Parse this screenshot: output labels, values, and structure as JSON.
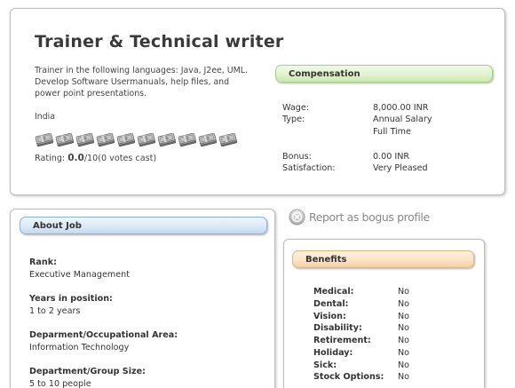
{
  "job": {
    "title": "Trainer & Technical writer",
    "description": "Trainer in the following languages: Java, J2ee, UML. Develop Software Usermanuals, help files, and power point presentations.",
    "location": "India",
    "rating_prefix": "Rating: ",
    "rating_value": "0.0",
    "rating_suffix": "/10(0 votes cast)",
    "rating_stars": 10,
    "rating_filled": 0
  },
  "compensation": {
    "header": "Compensation",
    "rows": [
      {
        "label": "Wage:",
        "value": "8,000.00 INR"
      },
      {
        "label": "Type:",
        "value": "Annual Salary"
      },
      {
        "label": "",
        "value": "Full Time"
      },
      {
        "label": "Bonus:",
        "value": "0.00 INR"
      },
      {
        "label": "Satisfaction:",
        "value": "Very Pleased"
      }
    ]
  },
  "report": {
    "label": "Report as bogus profile"
  },
  "about": {
    "header": "About Job",
    "items": [
      {
        "label": "Rank:",
        "value": "Executive Management"
      },
      {
        "label": "Years in position:",
        "value": "1 to 2 years"
      },
      {
        "label": "Deparment/Occupational Area:",
        "value": "Information Technology"
      },
      {
        "label": "Department/Group Size:",
        "value": "5 to 10 people"
      }
    ]
  },
  "benefits": {
    "header": "Benefits",
    "items": [
      {
        "label": "Medical:",
        "value": "No"
      },
      {
        "label": "Dental:",
        "value": "No"
      },
      {
        "label": "Vision:",
        "value": "No"
      },
      {
        "label": "Disability:",
        "value": "No"
      },
      {
        "label": "Retirement:",
        "value": "No"
      },
      {
        "label": "Holiday:",
        "value": "No"
      },
      {
        "label": "Sick:",
        "value": "No"
      },
      {
        "label": "Stock Options:",
        "value": "No"
      }
    ]
  },
  "colors": {
    "compensation_header": "#e1f2cd",
    "about_header": "#dbe9f7",
    "benefits_header": "#fbe3c6",
    "money_icon": "#8a8a8a"
  },
  "icons": {
    "rating": "money-stack-icon",
    "report": "circle-x-icon"
  }
}
